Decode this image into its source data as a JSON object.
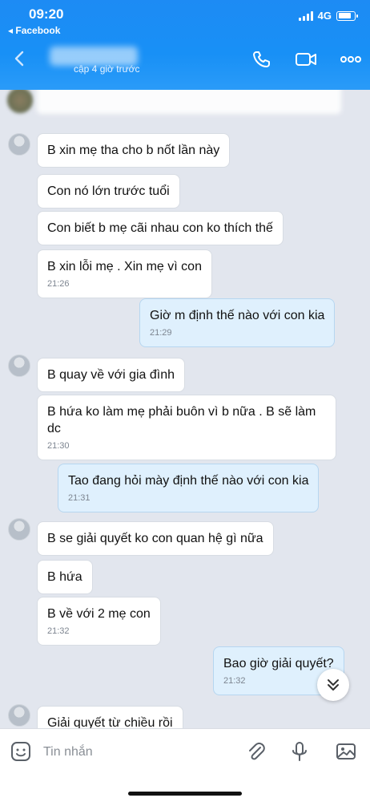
{
  "status": {
    "time": "09:20",
    "back_app": "◂ Facebook",
    "network": "4G"
  },
  "header": {
    "last_seen": "cập 4 giờ trước"
  },
  "messages": [
    {
      "text": "B xin mẹ tha cho b nốt lần này"
    },
    {
      "text": "Con nó lớn trước tuổi"
    },
    {
      "text": "Con biết b mẹ cãi nhau con ko thích thế"
    },
    {
      "text": "B xin lỗi mẹ .  Xin mẹ vì con",
      "time": "21:26"
    },
    {
      "text": "Giờ m định thế nào với con kia",
      "time": "21:29"
    },
    {
      "text": "B quay về với gia đình"
    },
    {
      "text": "B  hứa ko làm mẹ phải buôn vì b nữa . B sẽ làm dc",
      "time": "21:30"
    },
    {
      "text": "Tao đang hỏi mày định thế nào với con kia",
      "time": "21:31"
    },
    {
      "text": "B se giải quyết ko con quan hệ gì nữa"
    },
    {
      "text": "B hứa"
    },
    {
      "text": "B về với 2 mẹ con",
      "time": "21:32"
    },
    {
      "text": "Bao giờ giải quyết?",
      "time": "21:32"
    },
    {
      "text": "Giải quyết  từ chiều rồi"
    }
  ],
  "composer": {
    "placeholder": "Tin nhắn"
  }
}
